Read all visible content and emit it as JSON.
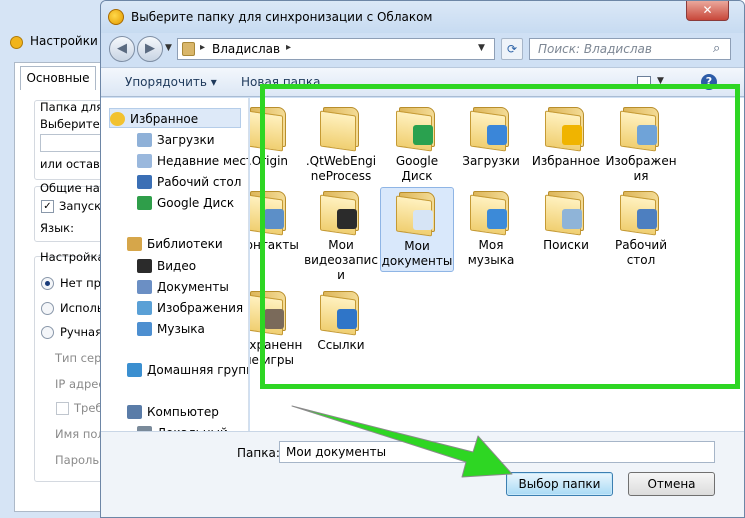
{
  "background_window": {
    "title": "Настройки",
    "tab": "Основные",
    "group1_title": "Папка для с",
    "group1_text": "Выберите п",
    "group1_text2": "или оставь",
    "group2_title": "Общие наст",
    "autostart": "Запуска",
    "language_label": "Язык:",
    "group3_title": "Настройка п",
    "radio1": "Нет про",
    "radio2": "Исполь",
    "radio3": "Ручная",
    "server_type": "Тип серв",
    "ip_address": "IP адрес",
    "require": "Требу",
    "user_name": "Имя пол",
    "password": "Пароль:"
  },
  "dialog": {
    "title": "Выберите папку для синхронизации с Облаком",
    "close_label": "✕",
    "address": {
      "path": "Владислав",
      "separator": "▸",
      "dropdown": "▼"
    },
    "search": {
      "placeholder": "Поиск: Владислав",
      "icon": "search-icon"
    },
    "toolbar": {
      "organize": "Упорядочить ▾",
      "new_folder": "Новая папка",
      "help": "?"
    },
    "navigation": [
      {
        "label": "Избранное",
        "icon": "favorites-star-icon"
      },
      {
        "label": "Загрузки",
        "icon": "downloads-folder-icon"
      },
      {
        "label": "Недавние места",
        "icon": "recent-places-icon"
      },
      {
        "label": "Рабочий стол",
        "icon": "desktop-icon"
      },
      {
        "label": "Google Диск",
        "icon": "google-drive-icon"
      },
      {
        "label": "Библиотеки",
        "icon": "libraries-icon"
      },
      {
        "label": "Видео",
        "icon": "video-library-icon"
      },
      {
        "label": "Документы",
        "icon": "documents-library-icon"
      },
      {
        "label": "Изображения",
        "icon": "pictures-library-icon"
      },
      {
        "label": "Музыка",
        "icon": "music-library-icon"
      },
      {
        "label": "Домашняя группа",
        "icon": "homegroup-icon"
      },
      {
        "label": "Компьютер",
        "icon": "computer-icon"
      },
      {
        "label": "Локальный",
        "icon": "local-disk-icon"
      }
    ],
    "folders": [
      {
        "label": ".Origin",
        "icon": "folder-icon"
      },
      {
        "label": ".QtWebEngineProcess",
        "icon": "folder-icon"
      },
      {
        "label": "Google Диск",
        "icon": "google-drive-folder-icon"
      },
      {
        "label": "Загрузки",
        "icon": "downloads-folder-icon"
      },
      {
        "label": "Избранное",
        "icon": "favorites-folder-icon"
      },
      {
        "label": "Изображения",
        "icon": "pictures-folder-icon"
      },
      {
        "label": "Контакты",
        "icon": "contacts-folder-icon"
      },
      {
        "label": "Мои видеозаписи",
        "icon": "videos-folder-icon"
      },
      {
        "label": "Мои документы",
        "icon": "documents-folder-icon"
      },
      {
        "label": "Моя музыка",
        "icon": "music-folder-icon"
      },
      {
        "label": "Поиски",
        "icon": "searches-folder-icon"
      },
      {
        "label": "Рабочий стол",
        "icon": "desktop-folder-icon"
      },
      {
        "label": "Сохраненные игры",
        "icon": "saved-games-folder-icon"
      },
      {
        "label": "Ссылки",
        "icon": "links-folder-icon"
      }
    ],
    "selected_folder": "Мои документы",
    "folder_label": "Папка:",
    "folder_value": "Мои документы",
    "select_button": "Выбор папки",
    "cancel_button": "Отмена"
  },
  "colors": {
    "highlight": "#2ed623",
    "arrow": "#2ed623"
  }
}
